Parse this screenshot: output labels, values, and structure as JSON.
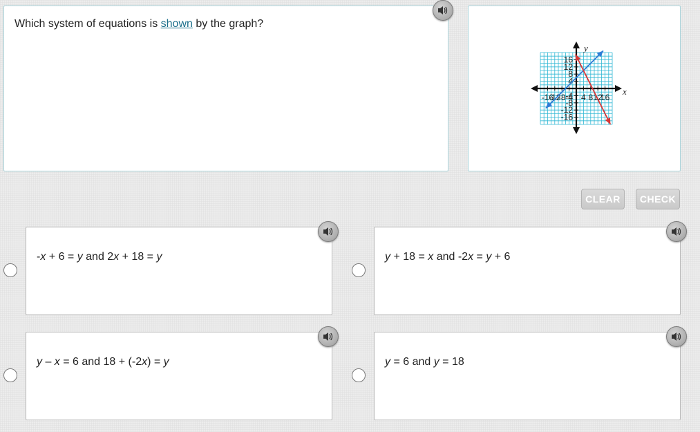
{
  "question": {
    "before": "Which system of equations is ",
    "link": "shown",
    "after": " by the graph?"
  },
  "buttons": {
    "clear": "CLEAR",
    "check": "CHECK"
  },
  "icons": {
    "audio": "speaker-icon"
  },
  "colors": {
    "grid": "#2fb7d4",
    "line_blue": "#2e7bd6",
    "line_red": "#d93838",
    "button_text": "#ffffff"
  },
  "choices": [
    {
      "id": "a",
      "parts": [
        [
          "-",
          false
        ],
        [
          "x",
          true
        ],
        [
          " + 6 = ",
          false
        ],
        [
          "y",
          true
        ],
        [
          " and 2",
          false
        ],
        [
          "x",
          true
        ],
        [
          " + 18 = ",
          false
        ],
        [
          "y",
          true
        ]
      ],
      "text": "-x + 6 = y and 2x + 18 = y"
    },
    {
      "id": "b",
      "parts": [
        [
          "y",
          true
        ],
        [
          " + 18 = ",
          false
        ],
        [
          "x",
          true
        ],
        [
          " and -2",
          false
        ],
        [
          "x",
          true
        ],
        [
          " = ",
          false
        ],
        [
          "y",
          true
        ],
        [
          " + 6",
          false
        ]
      ],
      "text": "y + 18 = x and -2x = y + 6"
    },
    {
      "id": "c",
      "parts": [
        [
          "y",
          true
        ],
        [
          " – ",
          false
        ],
        [
          "x",
          true
        ],
        [
          " = 6 and 18 + (-2",
          false
        ],
        [
          "x",
          true
        ],
        [
          ") = ",
          false
        ],
        [
          "y",
          true
        ]
      ],
      "text": "y – x = 6 and 18 + (-2x) = y"
    },
    {
      "id": "d",
      "parts": [
        [
          "y",
          true
        ],
        [
          " = 6 and ",
          false
        ],
        [
          "y",
          true
        ],
        [
          " = 18",
          false
        ]
      ],
      "text": "y = 6 and y = 18"
    }
  ],
  "chart_data": {
    "type": "line",
    "xlabel": "x",
    "ylabel": "y",
    "xlim": [
      -20,
      20
    ],
    "ylim": [
      -20,
      20
    ],
    "grid": true,
    "grid_step": 2,
    "x_ticks": [
      -16,
      -12,
      -8,
      -4,
      4,
      8,
      12,
      16
    ],
    "y_ticks": [
      16,
      12,
      8,
      4,
      -4,
      -8,
      -12,
      -16
    ],
    "series": [
      {
        "color": "#2e7bd6",
        "x": [
          -17,
          15
        ],
        "y": [
          -11,
          21
        ]
      },
      {
        "color": "#d93838",
        "x": [
          -0.5,
          19
        ],
        "y": [
          19,
          -20
        ]
      }
    ]
  }
}
